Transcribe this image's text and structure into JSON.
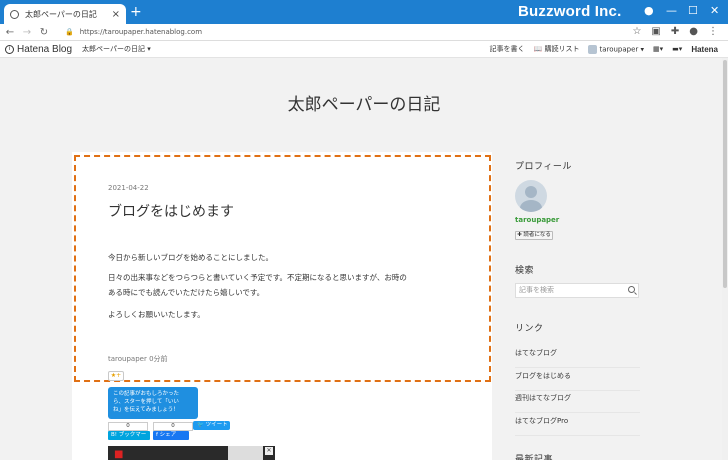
{
  "browser": {
    "tab_title": "太郎ペーパーの日記",
    "new_tab": "+",
    "brand": "Buzzword Inc.",
    "url": "https://taroupaper.hatenablog.com"
  },
  "hatena_header": {
    "logo_text": "Hatena Blog",
    "blog_menu": "太郎ペーパーの日記 ▾",
    "write": "記事を書く",
    "reading_list": "購読リスト",
    "user": "taroupaper ▾",
    "hatena_logo": "Hatena"
  },
  "blog_title": "太郎ペーパーの日記",
  "entry": {
    "date": "2021-04-22",
    "title": "ブログをはじめます",
    "paragraphs": [
      "今日から新しいブログを始めることにしました。",
      "日々の出来事などをつらつらと書いていく予定です。不定期になると思いますが、お時の",
      "ある時にでも読んでいただけたら嬉しいです。",
      "よろしくお願いいたします。"
    ],
    "meta": "taroupaper 0分前",
    "star_label": "★+",
    "tooltip_lines": [
      "この記事がおもしろかった",
      "ら、スターを押して「いい",
      "ね」を伝えてみましょう！"
    ],
    "bookmark_count": "0",
    "share_count": "0",
    "bookmark_label": "B! ブックマーク",
    "share_label": "f シェア",
    "tweet_label": "ツイート"
  },
  "sidebar": {
    "profile_heading": "プロフィール",
    "username": "taroupaper",
    "follow_label": "✚ 読者になる",
    "search_heading": "検索",
    "search_placeholder": "記事を検索",
    "links_heading": "リンク",
    "links": [
      "はてなブログ",
      "ブログをはじめる",
      "週刊はてなブログ",
      "はてなブログPro"
    ],
    "recent_heading": "最新記事"
  },
  "colors": {
    "titlebar": "#1e7fd0",
    "highlight_border": "#e07014",
    "tooltip": "#1f8fe0",
    "username": "#3a9b3a"
  }
}
